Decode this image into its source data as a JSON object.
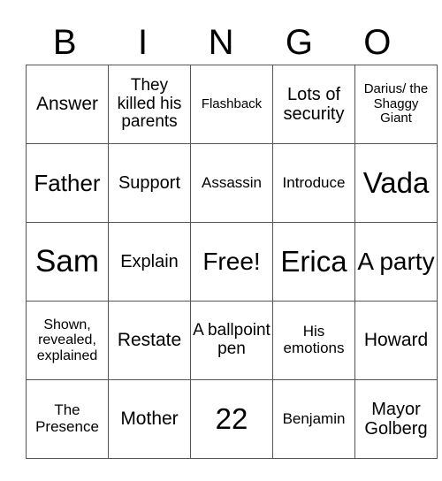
{
  "header": [
    "B",
    "I",
    "N",
    "G",
    "O"
  ],
  "cells": [
    [
      "Answer",
      "They killed his parents",
      "Flashback",
      "Lots of security",
      "Darius/ the Shaggy Giant"
    ],
    [
      "Father",
      "Support",
      "Assassin",
      "Introduce",
      "Vada"
    ],
    [
      "Sam",
      "Explain",
      "Free!",
      "Erica",
      "A party"
    ],
    [
      "Shown, revealed, explained",
      "Restate",
      "A ballpoint pen",
      "His emotions",
      "Howard"
    ],
    [
      "The Presence",
      "Mother",
      "22",
      "Benjamin",
      "Mayor Golberg"
    ]
  ]
}
